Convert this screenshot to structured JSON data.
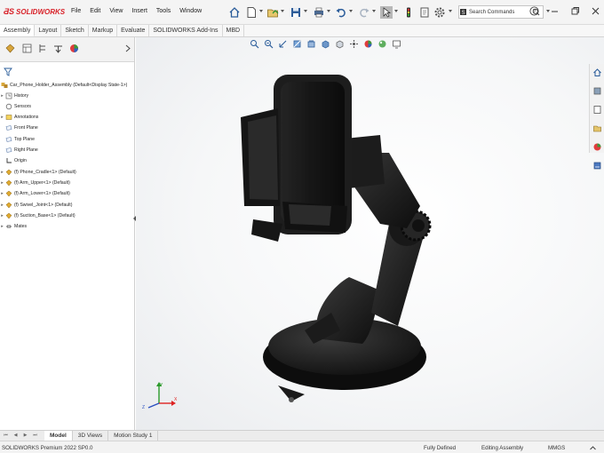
{
  "app": {
    "brand": "SOLIDWORKS",
    "brand_color": "#d8232a"
  },
  "menu": [
    "File",
    "Edit",
    "View",
    "Insert",
    "Tools",
    "Window"
  ],
  "search": {
    "label": "Search Commands"
  },
  "toolbar_icons": [
    "home-icon",
    "new-document-icon",
    "open-icon",
    "save-icon",
    "print-icon",
    "undo-icon",
    "redo-icon",
    "select-arrow-icon",
    "traffic-light-icon",
    "file-properties-icon",
    "options-gear-icon"
  ],
  "command_tabs": [
    "Assembly",
    "Layout",
    "Sketch",
    "Markup",
    "Evaluate",
    "SOLIDWORKS Add-Ins",
    "MBD"
  ],
  "active_command_tab": "Assembly",
  "feature_tree": {
    "root": "Car_Phone_Holder_Assembly  (Default<Display State-1>)",
    "items": [
      {
        "label": "History",
        "icon": "history-icon",
        "expand": true
      },
      {
        "label": "Sensors",
        "icon": "sensor-icon",
        "expand": false
      },
      {
        "label": "Annotations",
        "icon": "annotation-icon",
        "expand": true
      },
      {
        "label": "Front Plane",
        "icon": "plane-icon",
        "expand": false
      },
      {
        "label": "Top Plane",
        "icon": "plane-icon",
        "expand": false
      },
      {
        "label": "Right Plane",
        "icon": "plane-icon",
        "expand": false
      },
      {
        "label": "Origin",
        "icon": "origin-icon",
        "expand": false
      },
      {
        "label": "(f) Phone_Cradle<1> (Default)",
        "icon": "part-icon",
        "expand": true
      },
      {
        "label": "(f) Arm_Upper<1> (Default)",
        "icon": "part-icon",
        "expand": true
      },
      {
        "label": "(f) Arm_Lower<1> (Default)",
        "icon": "part-icon",
        "expand": true
      },
      {
        "label": "(f) Swivel_Joint<1> (Default)",
        "icon": "part-icon",
        "expand": true
      },
      {
        "label": "(f) Suction_Base<1> (Default)",
        "icon": "part-icon",
        "expand": true
      },
      {
        "label": "Mates",
        "icon": "mates-icon",
        "expand": true
      }
    ]
  },
  "bottom_tabs": [
    "Model",
    "3D Views",
    "Motion Study 1"
  ],
  "active_bottom_tab": "Model",
  "status": {
    "version": "SOLIDWORKS Premium 2022 SP0.0",
    "definition": "Fully Defined",
    "mode": "Editing Assembly",
    "units": "MMGS"
  }
}
